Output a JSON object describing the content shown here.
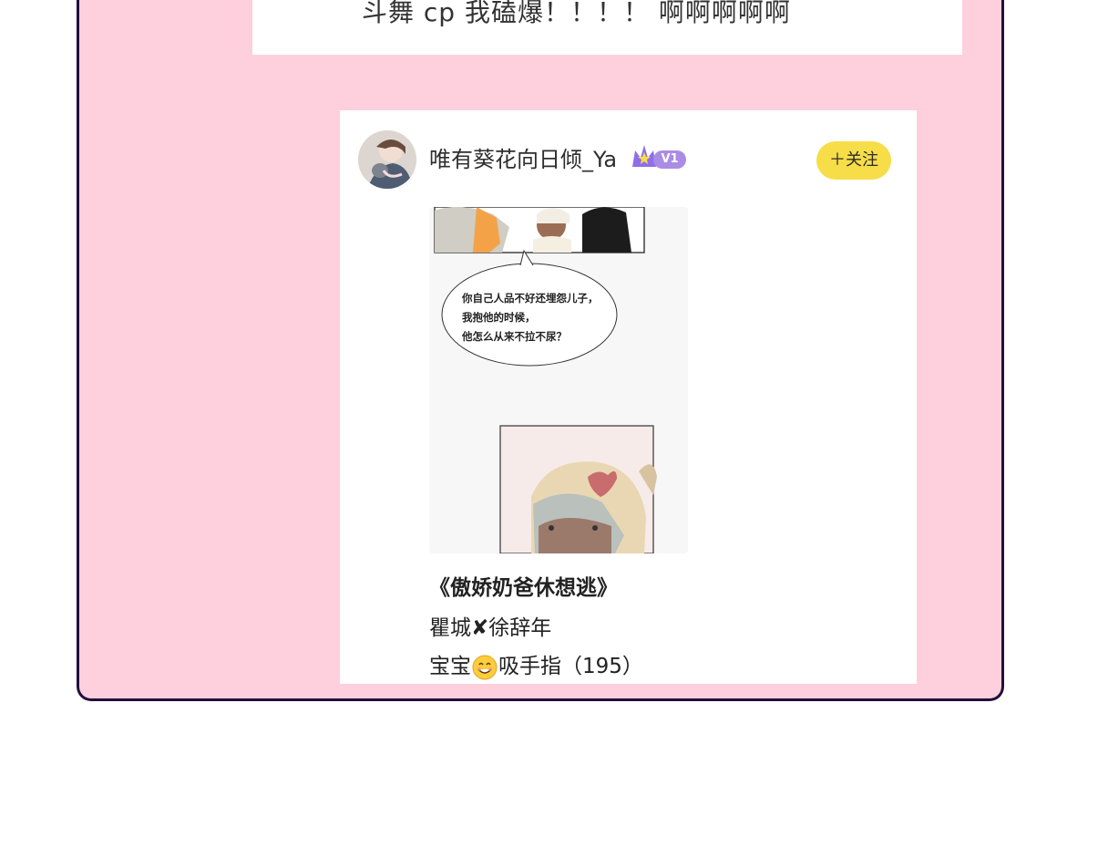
{
  "top_comment": {
    "text": "斗舞 cp 我磕爆！！！！ 啊啊啊啊啊"
  },
  "post": {
    "username": "唯有葵花向日倾_Ya",
    "vip_level": "V1",
    "follow_label": "＋关注",
    "comic_dialogue": [
      "你自己人品不好还埋怨儿子，",
      "我抱他的时候，",
      "他怎么从来不拉不尿？"
    ],
    "title": "《傲娇奶爸休想逃》",
    "line1_part1": "瞿城",
    "line1_separator": "✘",
    "line1_part2": "徐辞年",
    "line2_part1": "宝宝",
    "line2_part2": "吸手指（195）"
  },
  "colors": {
    "page_background": "#fecfdd",
    "frame_border": "#22103d",
    "follow_button": "#f7dd48",
    "vip_badge": "#a98ce6"
  },
  "icons": [
    "crown-icon",
    "smile-emoji-icon",
    "cross-icon"
  ]
}
